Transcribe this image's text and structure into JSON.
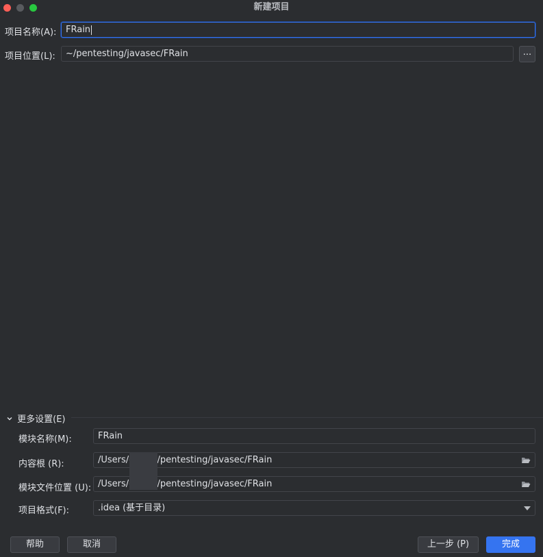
{
  "window": {
    "title": "新建项目"
  },
  "form": {
    "name_label": "项目名称(A):",
    "name_value": "FRain",
    "location_label": "项目位置(L):",
    "location_value": "~/pentesting/javasec/FRain",
    "browse_label": "..."
  },
  "more_settings": {
    "toggle_label": "更多设置(E)",
    "module_name_label": "模块名称(M):",
    "module_name_value": "FRain",
    "content_root_label": "内容根 (R):",
    "content_root_value": "/Users/g      n/pentesting/javasec/FRain",
    "module_file_label": "模块文件位置 (U):",
    "module_file_value": "/Users/g      n/pentesting/javasec/FRain",
    "format_label": "项目格式(F):",
    "format_value": ".idea (基于目录)"
  },
  "buttons": {
    "help": "帮助",
    "cancel": "取消",
    "previous": "上一步 (P)",
    "finish": "完成"
  },
  "colors": {
    "background": "#2b2d30",
    "accent": "#3574f0",
    "field_border": "#43454a"
  }
}
